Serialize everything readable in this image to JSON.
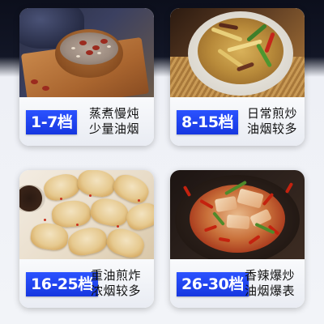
{
  "cards": [
    {
      "badge": "1-7档",
      "desc_line1": "蒸煮慢炖",
      "desc_line2": "少量油烟",
      "photo": "porridge-bowl-photo"
    },
    {
      "badge": "8-15档",
      "desc_line1": "日常煎炒",
      "desc_line2": "油烟较多",
      "photo": "stir-fry-photo"
    },
    {
      "badge": "16-25档",
      "desc_line1": "重油煎炸",
      "desc_line2": "浓烟较多",
      "photo": "fried-dumplings-photo"
    },
    {
      "badge": "26-30档",
      "desc_line1": "香辣爆炒",
      "desc_line2": "油烟爆表",
      "photo": "spicy-stir-fry-photo"
    }
  ],
  "colors": {
    "badge_blue": "#1f45f0",
    "text_dark": "#111111",
    "header_dark": "#0c0f1c"
  }
}
